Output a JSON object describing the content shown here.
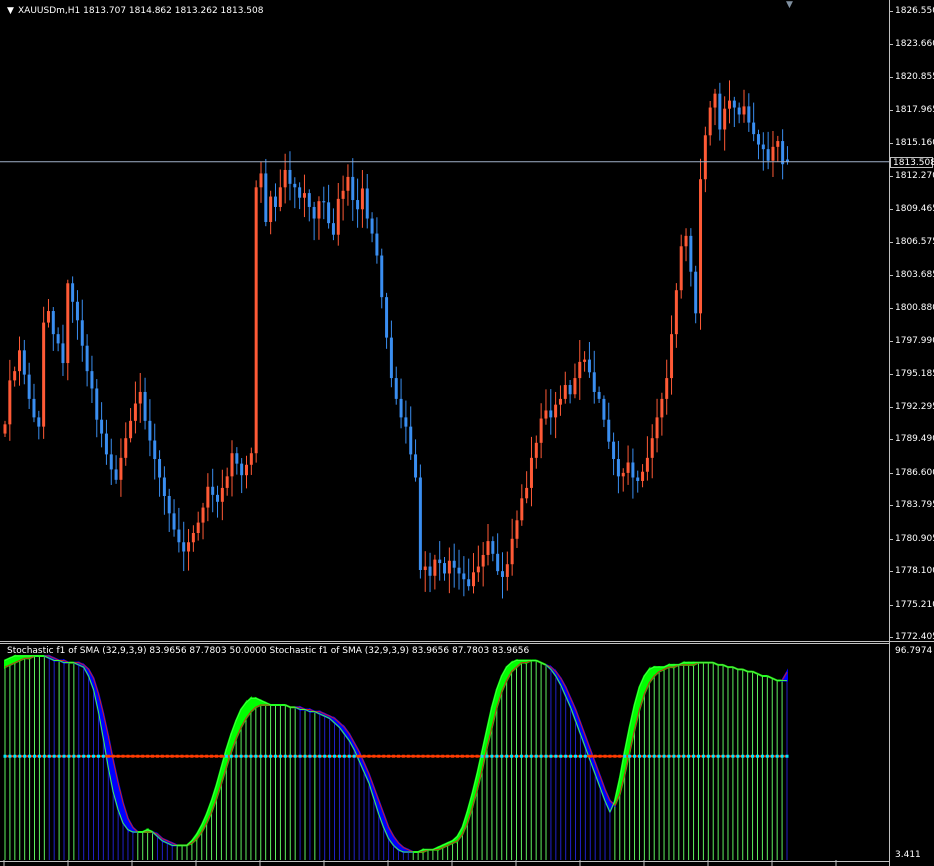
{
  "header": {
    "symbol_line": "XAUUSDm,H1  1813.707 1814.862 1813.262 1813.508",
    "indicator_line": "Stochastic f1 of SMA (32,9,3,9) 83.9656 87.7803 50.0000  Stochastic f1 of SMA (32,9,3,9) 83.9656 87.7803 83.9656"
  },
  "price_axis": {
    "labels": [
      "1826.550",
      "1823.660",
      "1820.855",
      "1817.965",
      "1815.160",
      "1812.270",
      "1809.465",
      "1806.575",
      "1803.685",
      "1800.880",
      "1797.990",
      "1795.185",
      "1792.295",
      "1789.490",
      "1786.600",
      "1783.795",
      "1780.905",
      "1778.100",
      "1775.210",
      "1772.405"
    ],
    "current_price": "1813.508"
  },
  "sub_axis": {
    "top_label": "96.7974",
    "bottom_label": "3.411"
  },
  "colors": {
    "bull": "#ff5a36",
    "bear": "#3a8ef0",
    "price_line": "#a0b0c8",
    "stoch_green": "#00ff00",
    "stoch_blue": "#0000ff",
    "level_line": "#ff3a00",
    "level_dots": "#00e5ff"
  },
  "chart_data": {
    "type": "candlestick",
    "symbol": "XAUUSDm",
    "timeframe": "H1",
    "last_ohlc": {
      "open": 1813.707,
      "high": 1814.862,
      "low": 1813.262,
      "close": 1813.508
    },
    "ylim": [
      1772.405,
      1826.55
    ],
    "closes": [
      1790.8,
      1794.6,
      1795.4,
      1797.2,
      1795.1,
      1793.0,
      1791.4,
      1790.6,
      1799.6,
      1800.6,
      1798.6,
      1797.8,
      1796.1,
      1803.0,
      1801.4,
      1799.8,
      1797.6,
      1795.4,
      1793.9,
      1791.2,
      1790.0,
      1788.2,
      1786.9,
      1786.0,
      1787.9,
      1789.6,
      1791.1,
      1792.6,
      1793.6,
      1791.1,
      1789.4,
      1787.8,
      1786.2,
      1784.6,
      1783.1,
      1781.7,
      1780.6,
      1779.8,
      1780.6,
      1781.4,
      1782.3,
      1783.6,
      1785.4,
      1784.7,
      1784.1,
      1785.3,
      1786.3,
      1788.3,
      1787.4,
      1786.4,
      1787.3,
      1788.3,
      1811.3,
      1812.5,
      1808.3,
      1810.5,
      1809.6,
      1811.3,
      1812.8,
      1811.6,
      1811.3,
      1810.4,
      1810.8,
      1809.6,
      1808.6,
      1810.1,
      1810.0,
      1808.2,
      1807.2,
      1810.3,
      1811.0,
      1812.2,
      1810.2,
      1809.4,
      1811.2,
      1808.6,
      1807.3,
      1805.4,
      1801.8,
      1798.3,
      1794.8,
      1793.0,
      1791.4,
      1790.6,
      1788.2,
      1786.2,
      1778.2,
      1778.5,
      1777.7,
      1779.1,
      1778.8,
      1777.9,
      1779.0,
      1778.4,
      1777.9,
      1777.4,
      1776.8,
      1778.0,
      1778.5,
      1779.5,
      1780.7,
      1779.6,
      1778.1,
      1777.6,
      1778.7,
      1780.9,
      1782.5,
      1784.4,
      1785.3,
      1787.9,
      1789.2,
      1791.3,
      1792.0,
      1791.4,
      1792.5,
      1793.0,
      1794.2,
      1793.4,
      1794.8,
      1796.2,
      1796.4,
      1795.3,
      1793.6,
      1793.0,
      1791.2,
      1789.3,
      1787.8,
      1786.3,
      1786.6,
      1787.5,
      1786.2,
      1785.9,
      1786.7,
      1787.9,
      1789.6,
      1791.4,
      1793.0,
      1794.8,
      1798.6,
      1802.4,
      1806.2,
      1807.1,
      1804.0,
      1800.4,
      1812.0,
      1815.8,
      1818.2,
      1819.4,
      1816.3,
      1818.1,
      1818.8,
      1818.2,
      1817.6,
      1818.3,
      1816.9,
      1815.9,
      1815.0,
      1814.6,
      1813.6,
      1814.8,
      1815.3,
      1813.3,
      1813.508
    ],
    "current_price": 1813.508,
    "indicator": {
      "name": "Stochastic f1 of SMA (32,9,3,9)",
      "values": [
        83.9656,
        87.7803
      ],
      "level": 50.0,
      "ylim": [
        3.411,
        96.7974
      ],
      "main": [
        93,
        94,
        95,
        95,
        95,
        95,
        95,
        95,
        95,
        94,
        93,
        93,
        92,
        92,
        92,
        91,
        90,
        86,
        80,
        70,
        58,
        45,
        34,
        26,
        20,
        17,
        16,
        16,
        16,
        17,
        16,
        14,
        12,
        11,
        10,
        10,
        10,
        10,
        12,
        15,
        19,
        24,
        30,
        37,
        45,
        53,
        60,
        66,
        71,
        74,
        76,
        76,
        75,
        74,
        73,
        73,
        73,
        73,
        72,
        72,
        71,
        71,
        70,
        70,
        69,
        68,
        67,
        65,
        63,
        60,
        57,
        53,
        48,
        43,
        38,
        31,
        24,
        18,
        13,
        10,
        8,
        7,
        7,
        7,
        7,
        8,
        8,
        8,
        9,
        10,
        11,
        12,
        14,
        18,
        25,
        33,
        42,
        52,
        62,
        72,
        80,
        86,
        90,
        92,
        93,
        93,
        93,
        93,
        93,
        92,
        91,
        89,
        86,
        82,
        77,
        72,
        66,
        60,
        54,
        48,
        42,
        36,
        30,
        25,
        30,
        40,
        52,
        63,
        73,
        81,
        86,
        89,
        90,
        90,
        90,
        91,
        91,
        91,
        92,
        92,
        92,
        92,
        92,
        92,
        92,
        91,
        91,
        90,
        90,
        89,
        89,
        88,
        88,
        87,
        86,
        86,
        85,
        84,
        84,
        83.9656
      ],
      "signal": [
        90,
        91,
        92,
        93,
        94,
        94,
        95,
        95,
        95,
        95,
        94,
        93,
        93,
        92,
        92,
        92,
        91,
        89,
        85,
        78,
        69,
        59,
        48,
        38,
        29,
        22,
        18,
        16,
        16,
        16,
        16,
        15,
        13,
        12,
        11,
        10,
        10,
        10,
        11,
        13,
        16,
        20,
        25,
        31,
        38,
        45,
        52,
        58,
        63,
        67,
        70,
        72,
        73,
        73,
        73,
        73,
        73,
        73,
        72,
        72,
        72,
        71,
        71,
        70,
        70,
        69,
        68,
        67,
        65,
        63,
        60,
        56,
        52,
        47,
        42,
        36,
        30,
        24,
        18,
        14,
        11,
        9,
        8,
        7,
        7,
        7,
        8,
        8,
        8,
        9,
        10,
        11,
        12,
        15,
        20,
        27,
        35,
        44,
        54,
        63,
        72,
        79,
        84,
        88,
        90,
        92,
        92,
        93,
        93,
        92,
        91,
        90,
        88,
        85,
        81,
        76,
        71,
        65,
        59,
        53,
        47,
        41,
        35,
        30,
        28,
        33,
        42,
        52,
        62,
        71,
        78,
        83,
        86,
        88,
        89,
        90,
        90,
        91,
        91,
        91,
        91,
        92,
        92,
        92,
        92,
        91,
        91,
        90,
        90,
        89,
        89,
        88,
        88,
        87,
        86,
        86,
        85,
        84,
        84,
        87.7803
      ]
    }
  }
}
